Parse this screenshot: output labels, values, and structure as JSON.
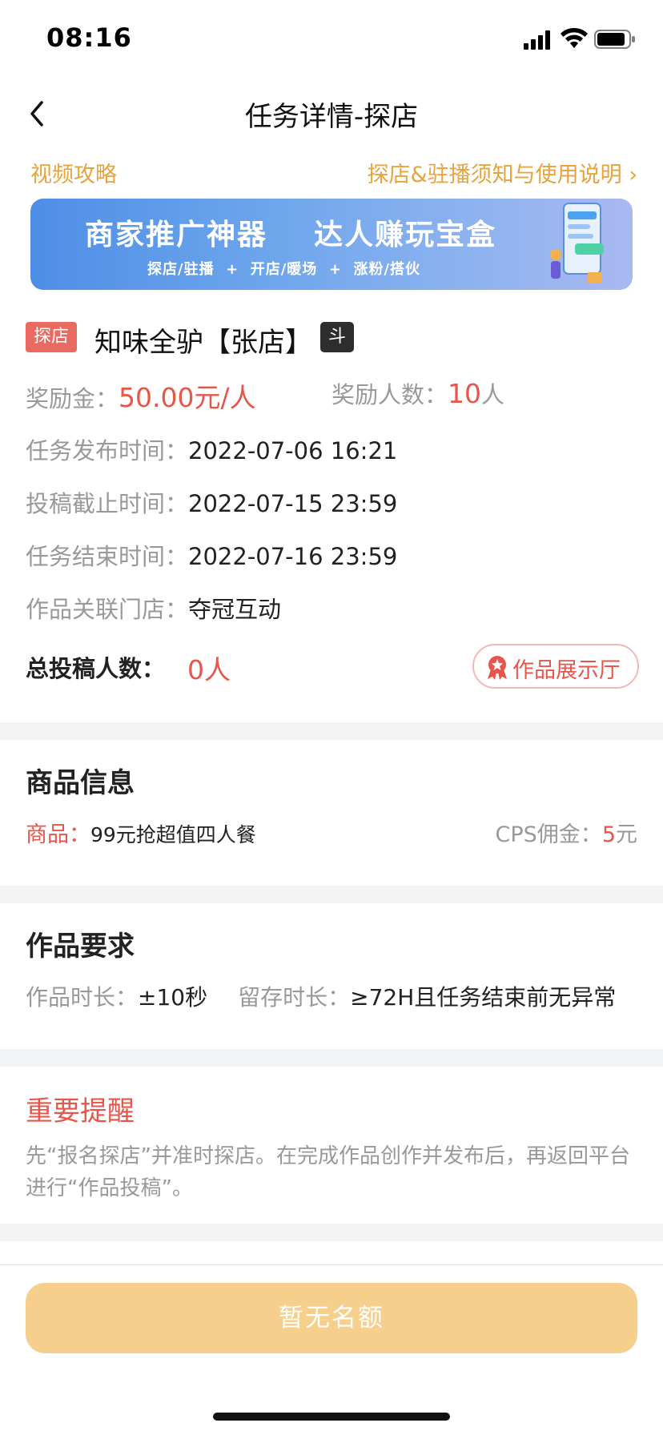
{
  "status_bar": {
    "time": "08:16"
  },
  "nav": {
    "title": "任务详情-探店"
  },
  "links": {
    "video_guide": "视频攻略",
    "instructions": "探店&驻播须知与使用说明 ›"
  },
  "banner": {
    "headline": "商家推广神器    达人赚玩宝盒",
    "subline": "探店/驻播  +  开店/暖场  +  涨粉/搭伙",
    "gradient_colors": [
      "#4e8ee6",
      "#a9b8f0"
    ]
  },
  "shop": {
    "tag": "探店",
    "name": "知味全驴【张店】",
    "platform_badge": "斗"
  },
  "reward": {
    "amount_label": "奖励金：",
    "amount_value": "50.00元/人",
    "people_label": "奖励人数：",
    "people_value": "10",
    "people_unit": "人"
  },
  "details": [
    {
      "label": "任务发布时间：",
      "value": "2022-07-06 16:21"
    },
    {
      "label": "投稿截止时间：",
      "value": "2022-07-15 23:59"
    },
    {
      "label": "任务结束时间：",
      "value": "2022-07-16 23:59"
    },
    {
      "label": "作品关联门店：",
      "value": "夺冠互动"
    }
  ],
  "total": {
    "label": "总投稿人数：",
    "value": "0人",
    "gallery_button": "作品展示厅"
  },
  "product_section": {
    "title": "商品信息",
    "product_label": "商品：",
    "product_name": "99元抢超值四人餐",
    "cps_label": "CPS佣金：",
    "cps_value": "5",
    "cps_unit": "元"
  },
  "requirements": {
    "title": "作品要求",
    "duration_label": "作品时长：",
    "duration_value": "±10秒",
    "retention_label": "留存时长：",
    "retention_value": "≥72H且任务结束前无异常"
  },
  "reminder": {
    "title": "重要提醒",
    "text": "先“报名探店”并准时探店。在完成作品创作并发布后，再返回平台进行“作品投稿”。"
  },
  "bottom": {
    "button_label": "暂无名额"
  },
  "colors": {
    "accent_red": "#e6564a",
    "link_orange": "#e8a33c",
    "button_disabled": "#f7cf8c"
  }
}
